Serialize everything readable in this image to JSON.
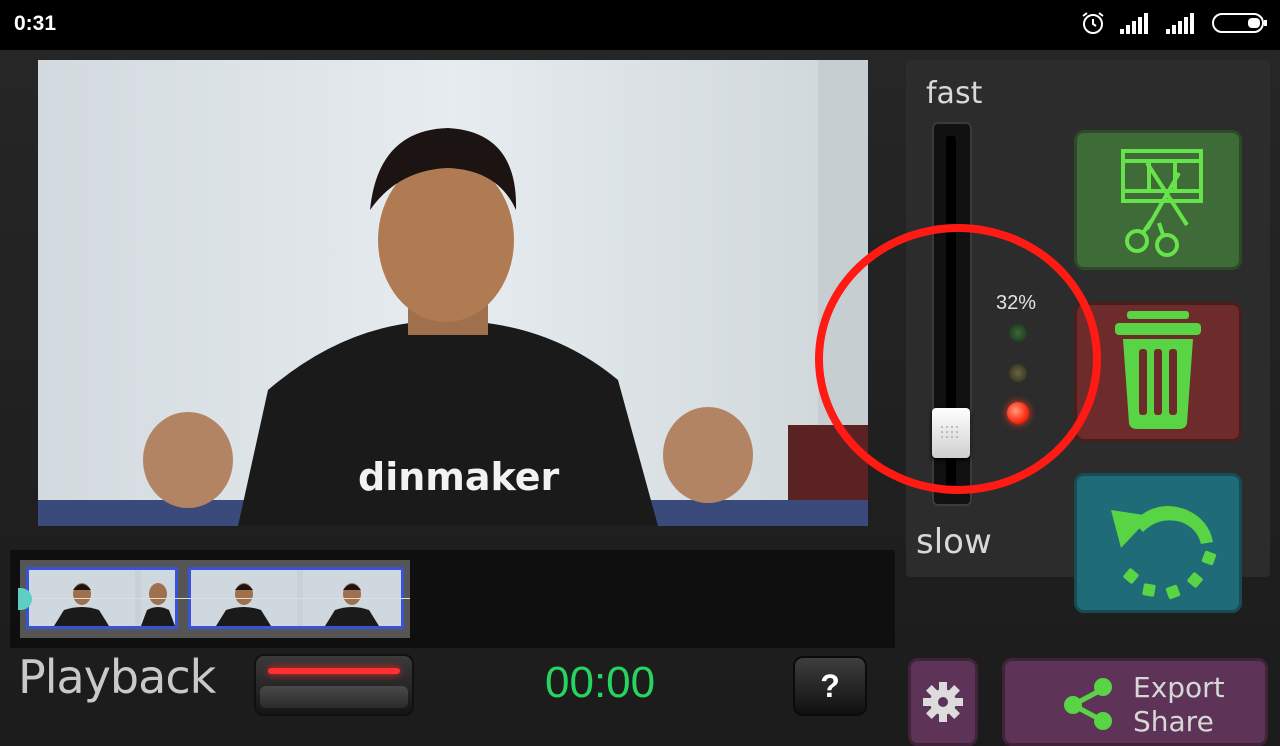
{
  "status_bar": {
    "time": "0:31",
    "icons": [
      "alarm-icon",
      "signal-icon",
      "signal-icon",
      "battery-icon"
    ]
  },
  "video": {
    "shirt_text": "dinmaker"
  },
  "timeline": {
    "clip_count": 2
  },
  "bottom_bar": {
    "mode_label": "Playback",
    "timer": "00:00",
    "help_label": "?"
  },
  "speed_panel": {
    "fast_label": "fast",
    "slow_label": "slow",
    "percent_label": "32%",
    "slider_level_pct": 32,
    "leds": [
      "green",
      "yellow",
      "red"
    ],
    "active_led": "red"
  },
  "actions": {
    "cut_icon": "film-scissors-icon",
    "delete_icon": "trash-icon",
    "undo_icon": "undo-icon",
    "settings_icon": "gear-icon",
    "export_icon": "share-icon",
    "export_label_line1": "Export",
    "export_label_line2": "Share"
  },
  "colors": {
    "timer": "#27d460",
    "record_red": "#ff3030",
    "cut_tile": "#3f6b38",
    "delete_tile": "#6e2b2b",
    "undo_tile": "#1f6b78",
    "purple_btn": "#5d3457",
    "annotation": "#ff1a14"
  }
}
